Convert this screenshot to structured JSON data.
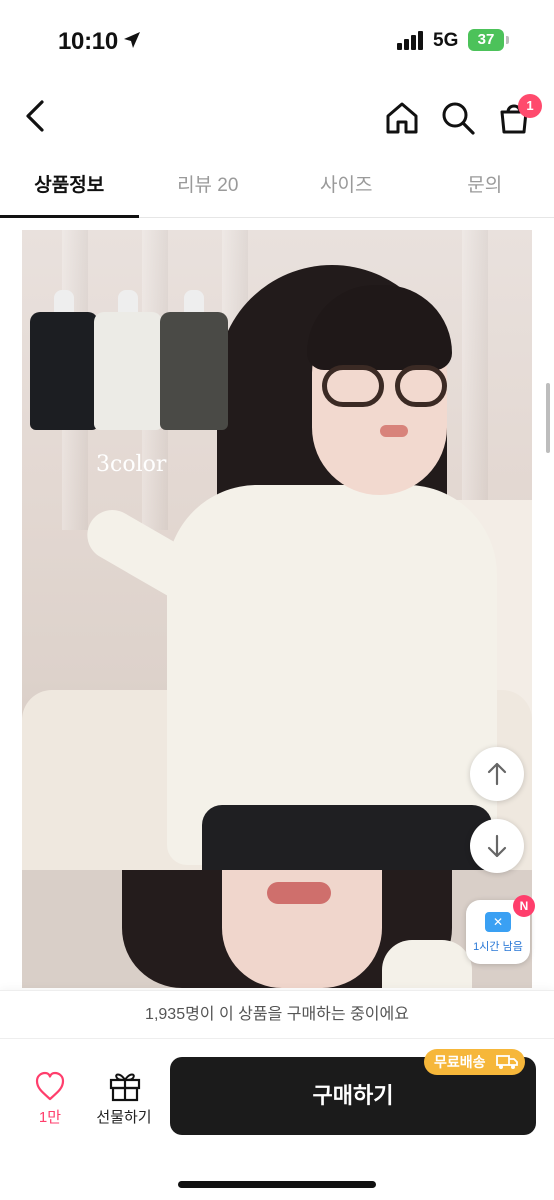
{
  "status_bar": {
    "time": "10:10",
    "network": "5G",
    "battery": "37"
  },
  "nav": {
    "cart_badge": "1"
  },
  "tabs": [
    {
      "label": "상품정보",
      "active": true
    },
    {
      "label": "리뷰 20",
      "active": false
    },
    {
      "label": "사이즈",
      "active": false
    },
    {
      "label": "문의",
      "active": false
    }
  ],
  "product": {
    "colors_label": "3color"
  },
  "coupon": {
    "label": "1시간 남음",
    "badge": "N"
  },
  "buyers_notice": "1,935명이 이 상품을 구매하는 중이에요",
  "bottom": {
    "like_count": "1만",
    "gift_label": "선물하기",
    "buy_label": "구매하기",
    "free_shipping": "무료배송"
  },
  "colors": {
    "accent_pink": "#ff3e6c",
    "shipping_orange": "#f6b73a",
    "buy_button": "#1b1b1b",
    "battery_green": "#4cc25a"
  }
}
